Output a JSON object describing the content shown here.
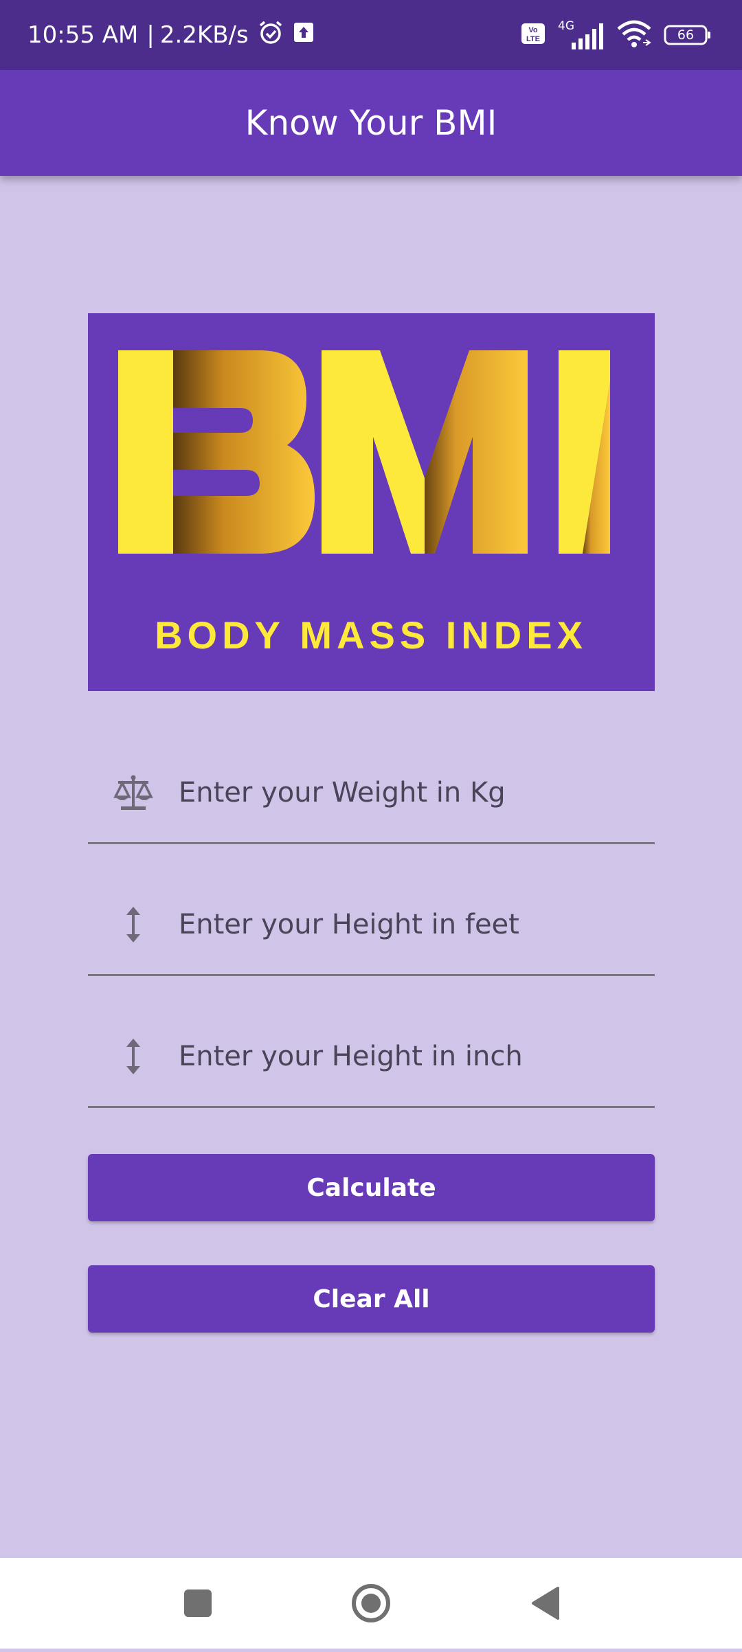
{
  "status_bar": {
    "time": "10:55 AM",
    "separator": "|",
    "speed": "2.2KB/s",
    "icons": [
      "alarm-icon",
      "upload-icon",
      "volte-icon",
      "signal-4g-icon",
      "wifi-icon",
      "battery-icon"
    ],
    "network_type": "4G",
    "volte_label": "Vo LTE",
    "battery": "66"
  },
  "app_bar": {
    "title": "Know Your BMI"
  },
  "logo": {
    "big_text": "BMI",
    "caption": "BODY MASS INDEX"
  },
  "fields": {
    "weight": {
      "placeholder": "Enter your Weight in Kg",
      "icon": "scale-icon"
    },
    "height_feet": {
      "placeholder": "Enter your Height in feet",
      "icon": "vertical-arrows-icon"
    },
    "height_inch": {
      "placeholder": "Enter your Height in inch",
      "icon": "vertical-arrows-icon"
    }
  },
  "buttons": {
    "calculate": "Calculate",
    "clear": "Clear All"
  },
  "nav_bar": {
    "icons": [
      "recents-square-icon",
      "home-circle-icon",
      "back-triangle-icon"
    ]
  },
  "colors": {
    "status_bar": "#4c2d8c",
    "primary": "#673ab7",
    "background": "#d0c4e8",
    "logo_yellow": "#fde93b"
  }
}
